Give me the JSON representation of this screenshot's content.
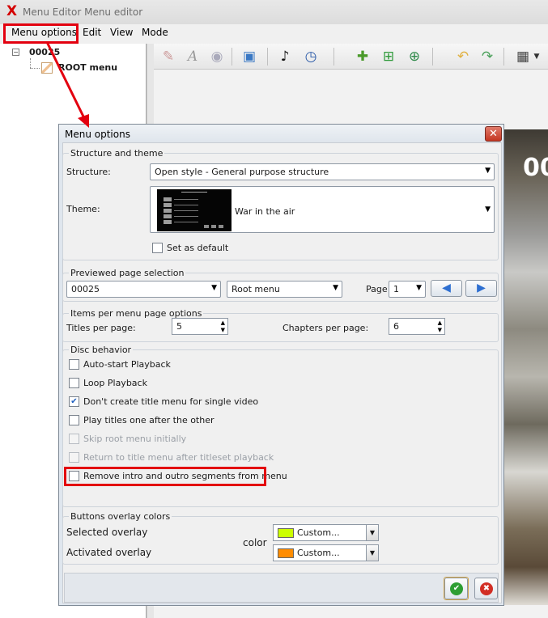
{
  "window": {
    "app_icon": "X",
    "title": "Menu Editor Menu editor"
  },
  "menubar": {
    "items": [
      "Menu options",
      "Edit",
      "View",
      "Mode"
    ]
  },
  "tree": {
    "root": "00025",
    "child": "ROOT menu"
  },
  "toolbar": {
    "icons": [
      "brush-icon",
      "text-icon",
      "eye-icon",
      "image-settings-icon",
      "music-icon",
      "timer-icon",
      "add-button-icon",
      "add-image-icon",
      "add-video-icon",
      "undo-icon",
      "redo-icon",
      "grid-icon",
      "chevron-down-icon"
    ]
  },
  "preview": {
    "text": "00"
  },
  "dialog": {
    "title": "Menu options",
    "structure_theme": {
      "group_label": "Structure and theme",
      "structure_label": "Structure:",
      "structure_value": "Open style - General purpose structure",
      "theme_label": "Theme:",
      "theme_value": "War in the air",
      "set_default_label": "Set as default",
      "set_default_checked": false
    },
    "previewed_page": {
      "group_label": "Previewed page selection",
      "title_value": "00025",
      "menu_value": "Root menu",
      "page_label": "Page",
      "page_value": "1"
    },
    "items_per_page": {
      "group_label": "Items per menu page options",
      "titles_label": "Titles per page:",
      "titles_value": "5",
      "chapters_label": "Chapters per page:",
      "chapters_value": "6"
    },
    "disc_behavior": {
      "group_label": "Disc behavior",
      "options": [
        {
          "label": "Auto-start Playback",
          "checked": false,
          "enabled": true
        },
        {
          "label": "Loop Playback",
          "checked": false,
          "enabled": true
        },
        {
          "label": "Don't create title menu for single video",
          "checked": true,
          "enabled": true
        },
        {
          "label": "Play titles one after the other",
          "checked": false,
          "enabled": true
        },
        {
          "label": "Skip root menu initially",
          "checked": false,
          "enabled": false
        },
        {
          "label": "Return to title menu after titleset playback",
          "checked": false,
          "enabled": false
        },
        {
          "label": "Remove intro and outro segments from menu",
          "checked": false,
          "enabled": true
        }
      ]
    },
    "overlay_colors": {
      "group_label": "Buttons overlay colors",
      "selected_label": "Selected overlay",
      "activated_label": "Activated overlay",
      "color_label": "color",
      "selected_value": "Custom...",
      "activated_value": "Custom...",
      "selected_color": "#ccff00",
      "activated_color": "#ff8c00"
    },
    "buttons": {
      "ok_symbol": "✔",
      "cancel_symbol": "✖"
    }
  },
  "colors": {
    "highlight": "#e3000f",
    "accent_blue": "#2e6fd1"
  }
}
